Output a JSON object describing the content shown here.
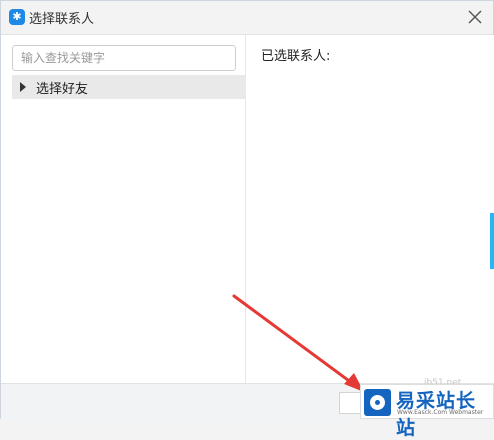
{
  "window": {
    "title": "选择联系人",
    "app_icon_glyph": "✱"
  },
  "left_panel": {
    "search_placeholder": "输入查找关键字",
    "group_label": "选择好友"
  },
  "right_panel": {
    "selected_label": "已选联系人:"
  },
  "watermark": {
    "site_name": "易采站长站",
    "site_url": "Www.Easck.Com Webmaster",
    "faint_url": "jb51.net"
  },
  "colors": {
    "accent": "#1e88e5",
    "arrow": "#e53935"
  }
}
